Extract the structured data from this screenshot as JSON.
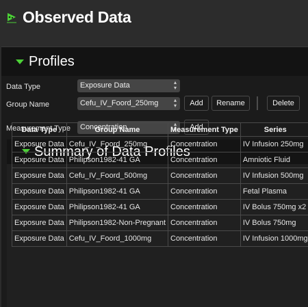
{
  "window": {
    "title": "Observed Data",
    "icon": "observed-data-icon"
  },
  "profiles": {
    "title": "Profiles",
    "data_type_label": "Data Type",
    "data_type_value": "Exposure Data",
    "group_name_label": "Group Name",
    "group_name_value": "Cefu_IV_Foord_250mg",
    "add_group_label": "Add",
    "rename_label": "Rename",
    "delete_label": "Delete",
    "measurement_type_label": "Measurement Type",
    "measurement_type_value": "Concentration",
    "add_measurement_label": "Add"
  },
  "summary": {
    "title": "Summary of Data Profiles",
    "columns": [
      "Data Type",
      "Group Name",
      "Measurement Type",
      "Series"
    ],
    "rows": [
      [
        "Exposure Data",
        "Cefu_IV_Foord_250mg",
        "Concentration",
        "IV Infusion 250mg"
      ],
      [
        "Exposure Data",
        "Philipson1982-41 GA",
        "Concentration",
        "Amniotic Fluid"
      ],
      [
        "Exposure Data",
        "Cefu_IV_Foord_500mg",
        "Concentration",
        "IV Infusion 500mg"
      ],
      [
        "Exposure Data",
        "Philipson1982-41 GA",
        "Concentration",
        "Fetal Plasma"
      ],
      [
        "Exposure Data",
        "Philipson1982-41 GA",
        "Concentration",
        "IV Bolus 750mg x2"
      ],
      [
        "Exposure Data",
        "Philipson1982-Non-Pregnant",
        "Concentration",
        "IV Bolus 750mg"
      ],
      [
        "Exposure Data",
        "Cefu_IV_Foord_1000mg",
        "Concentration",
        "IV Infusion 1000mg"
      ]
    ]
  },
  "colors": {
    "accent": "#4cd137",
    "background": "#2c2c2c",
    "panel": "#1b1b1b"
  }
}
